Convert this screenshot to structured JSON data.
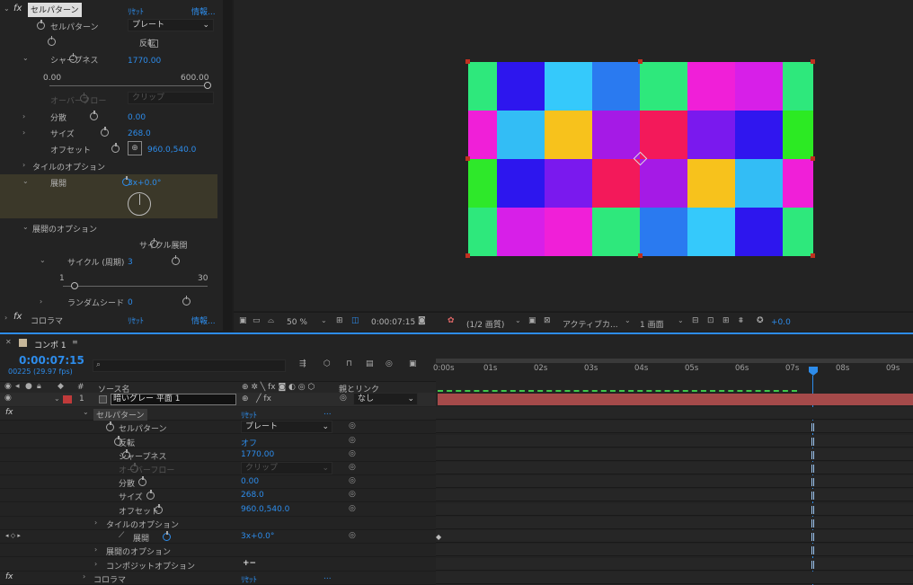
{
  "effects_panel": {
    "effect1": {
      "fx": "fx",
      "name": "セルパターン",
      "reset": "ﾘｾｯﾄ",
      "info": "情報..."
    },
    "rows": {
      "cell_pattern": {
        "label": "セルパターン",
        "value": "プレート"
      },
      "invert": {
        "label": "反転"
      },
      "sharpness": {
        "label": "シャープネス",
        "value": "1770.00"
      },
      "slider_min": "0.00",
      "slider_max": "600.00",
      "overflow": {
        "label": "オーバーフロー",
        "value": "クリップ"
      },
      "disperse": {
        "label": "分散",
        "value": "0.00"
      },
      "size": {
        "label": "サイズ",
        "value": "268.0"
      },
      "offset": {
        "label": "オフセット",
        "value": "960.0,540.0"
      },
      "tile_options": {
        "label": "タイルのオプション"
      },
      "evolution": {
        "label": "展開",
        "value": "3x+0.0°"
      },
      "evolution_options": {
        "label": "展開のオプション"
      },
      "cycle_evolution": {
        "label": "サイクル展開"
      },
      "cycle": {
        "label": "サイクル (周期)",
        "value": "3"
      },
      "cycle_min": "1",
      "cycle_max": "30",
      "random_seed": {
        "label": "ランダムシード",
        "value": "0"
      }
    },
    "effect2": {
      "fx": "fx",
      "name": "コロラマ",
      "reset": "ﾘｾｯﾄ",
      "info": "情報..."
    }
  },
  "viewer": {
    "tiles": [
      [
        "#2ee87c",
        "#2d16ee",
        "#35c9fb",
        "#2a7af0",
        "#2ee87c",
        "#f01fd8",
        "#d71fe8",
        "#2ee87c"
      ],
      [
        "#f01fd8",
        "#33bdf5",
        "#f7c21c",
        "#a51ae6",
        "#f3195a",
        "#7a19ee",
        "#3016ef",
        "#2cea23"
      ],
      [
        "#2ee82a",
        "#2d16ee",
        "#7a19ee",
        "#f3195a",
        "#a51ae6",
        "#f7c21c",
        "#33bdf5",
        "#f01fd8"
      ],
      [
        "#2ee87c",
        "#d71fe8",
        "#f01fd8",
        "#2ee87c",
        "#2a7af0",
        "#35c9fb",
        "#2d16ee",
        "#2ee87c"
      ]
    ],
    "toolbar": {
      "zoom": "50 %",
      "timecode": "0:00:07:15",
      "resolution": "(1/2 画質)",
      "camera": "アクティブカ...",
      "views": "1 画面",
      "exposure": "+0.0"
    }
  },
  "timeline": {
    "tab": "コンポ 1",
    "timecode": "0:00:07:15",
    "frames": "00225 (29.97 fps)",
    "search_placeholder": "",
    "columns": {
      "num": "#",
      "source": "ソース名",
      "parent": "親とリンク"
    },
    "ruler": [
      "0:00s",
      "01s",
      "02s",
      "03s",
      "04s",
      "05s",
      "06s",
      "07s",
      "08s",
      "09s"
    ],
    "layer": {
      "num": "1",
      "name": "暗いグレー 平面 1",
      "parent": "なし"
    },
    "props": {
      "effect": "セルパターン",
      "reset": "ﾘｾｯﾄ",
      "dots": "...",
      "cell_pattern": {
        "label": "セルパターン",
        "value": "プレート"
      },
      "invert": {
        "label": "反転",
        "value": "オフ"
      },
      "sharpness": {
        "label": "シャープネス",
        "value": "1770.00"
      },
      "overflow": {
        "label": "オーバーフロー",
        "value": "クリップ"
      },
      "disperse": {
        "label": "分散",
        "value": "0.00"
      },
      "size": {
        "label": "サイズ",
        "value": "268.0"
      },
      "offset": {
        "label": "オフセット",
        "value": "960.0,540.0"
      },
      "tile_options": "タイルのオプション",
      "evolution": {
        "label": "展開",
        "value": "3x+0.0°"
      },
      "evolution_options": "展開のオプション",
      "composite_options": {
        "label": "コンポジットオプション",
        "value": "+−"
      },
      "effect2": "コロラマ"
    }
  }
}
